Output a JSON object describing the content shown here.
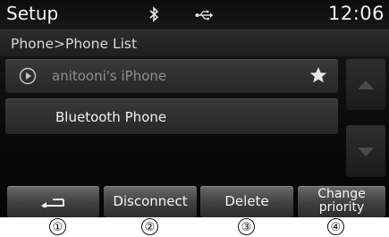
{
  "status_bar": {
    "title": "Setup",
    "time": "12:06",
    "icons": [
      "bluetooth-icon",
      "usb-icon"
    ]
  },
  "breadcrumb": "Phone>Phone List",
  "phone_list": {
    "items": [
      {
        "label": "anitooni's iPhone",
        "state": "connected",
        "icon": "play-icon",
        "favorite": true
      },
      {
        "label": "Bluetooth Phone",
        "state": "paired",
        "favorite": false
      }
    ]
  },
  "scroll": {
    "up_icon": "triangle-up-icon",
    "down_icon": "triangle-down-icon"
  },
  "buttons": {
    "back_icon": "back-arrow-icon",
    "disconnect": "Disconnect",
    "delete": "Delete",
    "change_priority_line1": "Change",
    "change_priority_line2": "priority"
  },
  "callouts": [
    "①",
    "②",
    "③",
    "④"
  ],
  "colors": {
    "screen_bg": "#0a0a0a",
    "button_face": "#4f4f4f",
    "dim_text": "#8e8e8e",
    "text": "#f2f2f2"
  }
}
